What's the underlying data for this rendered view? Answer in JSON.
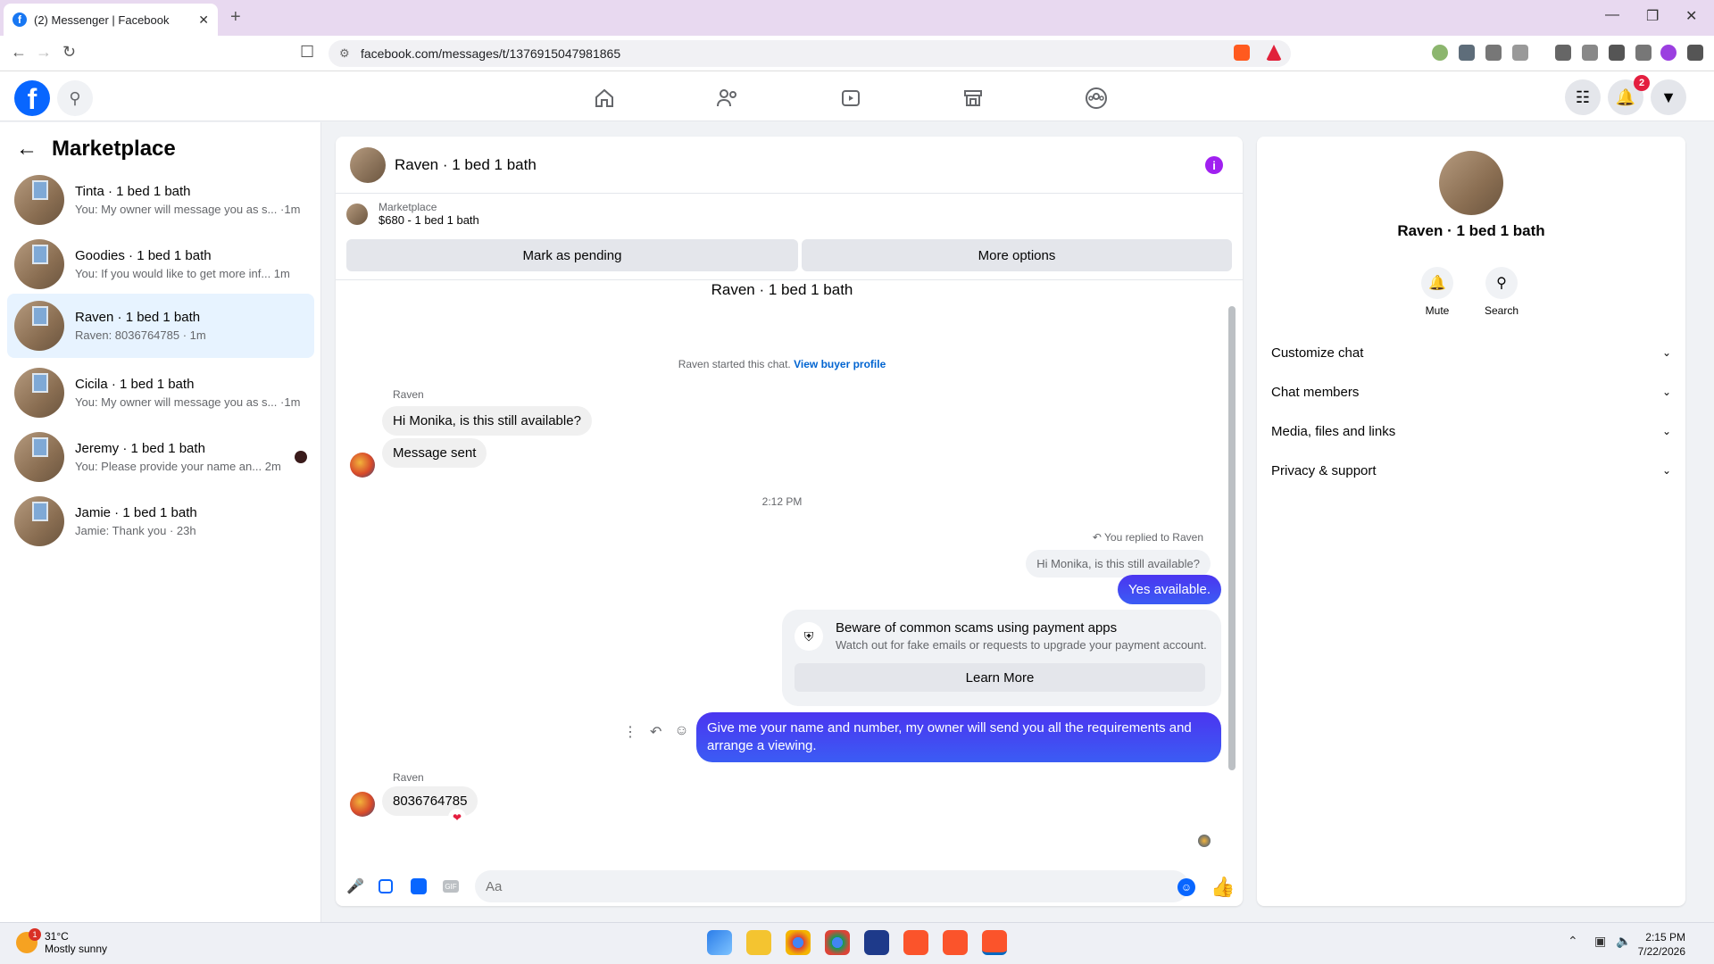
{
  "browser": {
    "tab_title": "(2) Messenger | Facebook",
    "url": "facebook.com/messages/t/1376915047981865",
    "tab_close": "✕",
    "new_tab": "+"
  },
  "fb": {
    "notif_count": "2"
  },
  "sidebar": {
    "title": "Marketplace",
    "conversations": [
      {
        "name": "Tinta · 1 bed 1 bath",
        "preview": "You: My owner will message you as s... ·1m"
      },
      {
        "name": "Goodies · 1 bed 1 bath",
        "preview": "You: If you would like to get more inf...  1m"
      },
      {
        "name": "Raven · 1 bed 1 bath",
        "preview": "Raven: 8036764785 · 1m"
      },
      {
        "name": "Cicila · 1 bed 1 bath",
        "preview": "You: My owner will message you as s... ·1m"
      },
      {
        "name": "Jeremy · 1 bed 1 bath",
        "preview": "You: Please provide your name an...   2m"
      },
      {
        "name": "Jamie · 1 bed 1 bath",
        "preview": "Jamie: Thank you · 23h"
      }
    ]
  },
  "chat": {
    "header_name": "Raven · 1 bed 1 bath",
    "listing_label": "Marketplace",
    "listing_value": "$680 - 1 bed 1 bath",
    "mark_pending": "Mark as pending",
    "more_options": "More options",
    "thread_title": "Raven · 1 bed 1 bath",
    "started_text": "Raven started this chat.",
    "buyer_profile_link": "View buyer profile",
    "sender_name": "Raven",
    "msg1": "Hi Monika, is this still available?",
    "msg2": "Message sent",
    "timestamp": "2:12 PM",
    "replied_to": "You replied to Raven",
    "quoted": "Hi Monika, is this still available?",
    "reply_out": "Yes available.",
    "scam_title": "Beware of common scams using payment apps",
    "scam_sub": "Watch out for fake emails or requests to upgrade your payment account.",
    "learn_more": "Learn More",
    "out_msg": "Give me your name and number, my owner will send you all the requirements and arrange a viewing.",
    "sender_name2": "Raven",
    "phone_msg": "8036764785",
    "composer_placeholder": "Aa"
  },
  "details": {
    "name": "Raven · 1 bed 1 bath",
    "mute": "Mute",
    "search": "Search",
    "sections": [
      "Customize chat",
      "Chat members",
      "Media, files and links",
      "Privacy & support"
    ]
  },
  "taskbar": {
    "temp": "31°C",
    "weather": "Mostly sunny",
    "weather_badge": "1",
    "time": "2:15 PM",
    "date": "7/22/2026"
  },
  "colors": {
    "fb_blue": "#0866ff",
    "bubble_out": "#4b35f0",
    "active_conv": "#e7f3ff"
  }
}
